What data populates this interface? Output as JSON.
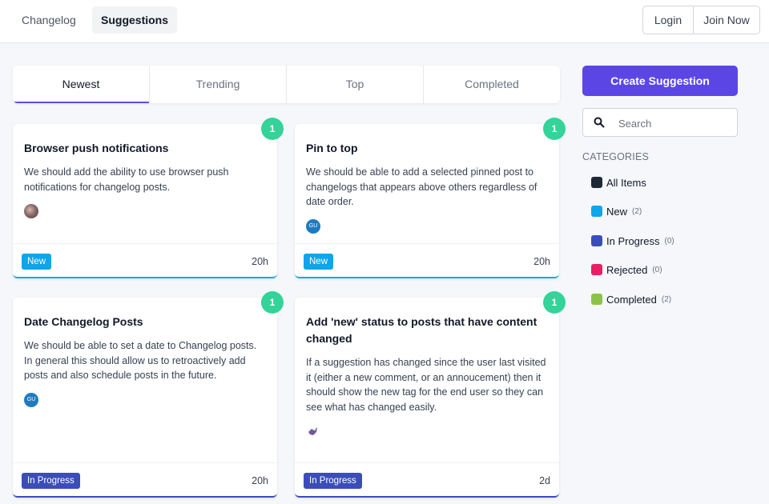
{
  "nav": {
    "changelog": "Changelog",
    "suggestions": "Suggestions"
  },
  "auth": {
    "login": "Login",
    "join": "Join Now"
  },
  "tabs": [
    "Newest",
    "Trending",
    "Top",
    "Completed"
  ],
  "cards": [
    {
      "title": "Browser push notifications",
      "desc": "We should add the ability to use browser push notifications for changelog posts.",
      "votes": "1",
      "avatar": "",
      "status": "New",
      "time": "20h"
    },
    {
      "title": "Pin to top",
      "desc": "We should be able to add a selected pinned post to changelogs that appears above others regardless of date order.",
      "votes": "1",
      "avatar": "GU",
      "status": "New",
      "time": "20h"
    },
    {
      "title": "Date Changelog Posts",
      "desc": "We should be able to set a date to Changelog posts. In general this should allow us to retroactively add posts and also schedule posts in the future.",
      "votes": "1",
      "avatar": "GU",
      "status": "In Progress",
      "time": "20h"
    },
    {
      "title": "Add 'new' status to posts that have content changed",
      "desc": "If a suggestion has changed since the user last visited it (either a new comment, or an annoucement) then it should show the new tag for the end user so they can see what has changed easily.",
      "votes": "1",
      "avatar": "",
      "status": "In Progress",
      "time": "2d"
    }
  ],
  "sidebar": {
    "create": "Create Suggestion",
    "search_placeholder": "Search",
    "categories_heading": "CATEGORIES",
    "categories": [
      {
        "label": "All Items",
        "count": "",
        "color": "#1f2937"
      },
      {
        "label": "New",
        "count": "(2)",
        "color": "#0ea5e9"
      },
      {
        "label": "In Progress",
        "count": "(0)",
        "color": "#3b4db8"
      },
      {
        "label": "Rejected",
        "count": "(0)",
        "color": "#e91e63"
      },
      {
        "label": "Completed",
        "count": "(2)",
        "color": "#8bc34a"
      }
    ]
  }
}
